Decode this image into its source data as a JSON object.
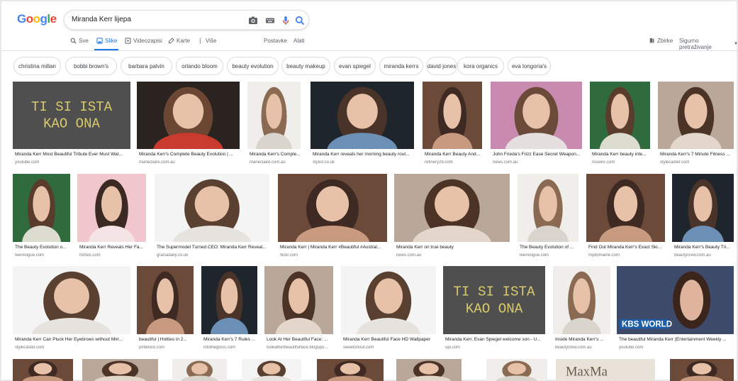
{
  "logo": {
    "letters": [
      "G",
      "o",
      "o",
      "g",
      "l",
      "e"
    ],
    "colors": [
      "#4285f4",
      "#ea4335",
      "#fbbc05",
      "#4285f4",
      "#34a853",
      "#ea4335"
    ]
  },
  "search": {
    "query": "Miranda Kerr lijepa"
  },
  "tabs": [
    {
      "label": "Sve",
      "icon": "search-icon"
    },
    {
      "label": "Slike",
      "icon": "image-icon"
    },
    {
      "label": "Videozapisi",
      "icon": "video-icon"
    },
    {
      "label": "Karte",
      "icon": "map-icon"
    },
    {
      "label": "Više",
      "icon": "more-icon"
    }
  ],
  "tools": {
    "settings": "Postavke",
    "tools": "Alati"
  },
  "header_right": {
    "collections": "Zbirke",
    "safesearch": "Sigurno pretraživanje"
  },
  "chips": [
    "christina milian",
    "bobbi brown's",
    "barbara palvin",
    "orlando bloom",
    "beauty evolution",
    "beauty makeup",
    "evan spiegel",
    "miranda kerrs",
    "david jones",
    "kora organics",
    "eva longoria's"
  ],
  "results": [
    {
      "title": "Miranda Kerr Most Beautiful Tribute Ever Must Wat...",
      "source": "youtube.com",
      "art": "sign",
      "thumb_text": [
        "TI SI ISTA",
        "KAO ONA"
      ]
    },
    {
      "title": "Miranda Kerr's Complete Beauty Evolution | ...",
      "source": "marieclaire.com.au",
      "art": "red"
    },
    {
      "title": "Miranda Kerr's Comple...",
      "source": "marieclaire.com.au",
      "art": "light"
    },
    {
      "title": "Miranda Kerr reveals her morning beauty rout...",
      "source": "stylist.co.uk",
      "art": "blue"
    },
    {
      "title": "Miranda Kerr Beauty And...",
      "source": "refinery29.com",
      "art": "warm"
    },
    {
      "title": "John Frieda's Frizz Ease Secret Weapon...",
      "source": "news.com.au",
      "art": "flowers"
    },
    {
      "title": "Miranda Kerr beauty inte...",
      "source": "roseinc.com",
      "art": "green"
    },
    {
      "title": "Miranda Kerr's 7 Minute Fitness ...",
      "source": "stylecaster.com",
      "art": "neutral"
    },
    {
      "title": "The Beauty Evolution o...",
      "source": "teenvogue.com",
      "art": "green"
    },
    {
      "title": "Miranda Kerr Reveals Her Fa...",
      "source": "forbes.com",
      "art": "pink"
    },
    {
      "title": "The Supermodel Turned CEO: Miranda Kerr Reveal...",
      "source": "graziadaily.co.uk",
      "art": "white"
    },
    {
      "title": "Miranda Kerr | Miranda Kerr #Beautiful #Austral...",
      "source": "flickr.com",
      "art": "warm"
    },
    {
      "title": "Miranda Kerr on true beauty",
      "source": "news.com.au",
      "art": "neutral"
    },
    {
      "title": "The Beauty Evolution of ...",
      "source": "teenvogue.com",
      "art": "light"
    },
    {
      "title": "Find Out Miranda Kerr's Exact Ski...",
      "source": "mydomaine.com",
      "art": "warm"
    },
    {
      "title": "Miranda Kerr's Beauty Tri...",
      "source": "beautycrew.com.au",
      "art": "blue"
    },
    {
      "title": "Miranda Kerr Can Pluck Her Eyebrows without Mirr...",
      "source": "stylecaster.com",
      "art": "white"
    },
    {
      "title": "beautiful | Hotties in 2...",
      "source": "pinterest.com",
      "art": "warm"
    },
    {
      "title": "Miranda Kerr's 7 Rules ...",
      "source": "intothegloss.com",
      "art": "blue"
    },
    {
      "title": "Look At Her Beautiful Face: ...",
      "source": "lookatherbeautifulface.blogspo...",
      "art": "neutral"
    },
    {
      "title": "Miranda Kerr Beautiful Face HD Wallpaper",
      "source": "sweetshout.com",
      "art": "white"
    },
    {
      "title": "Miranda Kerr, Evan Spiegel welcome son - U...",
      "source": "upi.com",
      "art": "sign",
      "thumb_text": [
        "TI SI ISTA",
        "KAO ONA"
      ]
    },
    {
      "title": "Inside Miranda Kerr's ...",
      "source": "beautycrew.com.au",
      "art": "light"
    },
    {
      "title": "The beautiful Miranda Kerr (Entertainment Weekly ...",
      "source": "youtube.com",
      "art": "kbs",
      "thumb_text": [
        "KBS WORLD"
      ]
    },
    {
      "title": "",
      "source": "",
      "art": "warm"
    },
    {
      "title": "",
      "source": "",
      "art": "neutral"
    },
    {
      "title": "",
      "source": "",
      "art": "light"
    },
    {
      "title": "",
      "source": "",
      "art": "white"
    },
    {
      "title": "",
      "source": "",
      "art": "warm"
    },
    {
      "title": "",
      "source": "",
      "art": "neutral"
    },
    {
      "title": "",
      "source": "",
      "art": "light"
    },
    {
      "title": "",
      "source": "",
      "art": "maxmara",
      "thumb_text": [
        "MaxMa"
      ]
    },
    {
      "title": "",
      "source": "",
      "art": "warm"
    }
  ],
  "colors": {
    "accent": "#1a73e8",
    "text": "#202124",
    "muted": "#70757a"
  }
}
